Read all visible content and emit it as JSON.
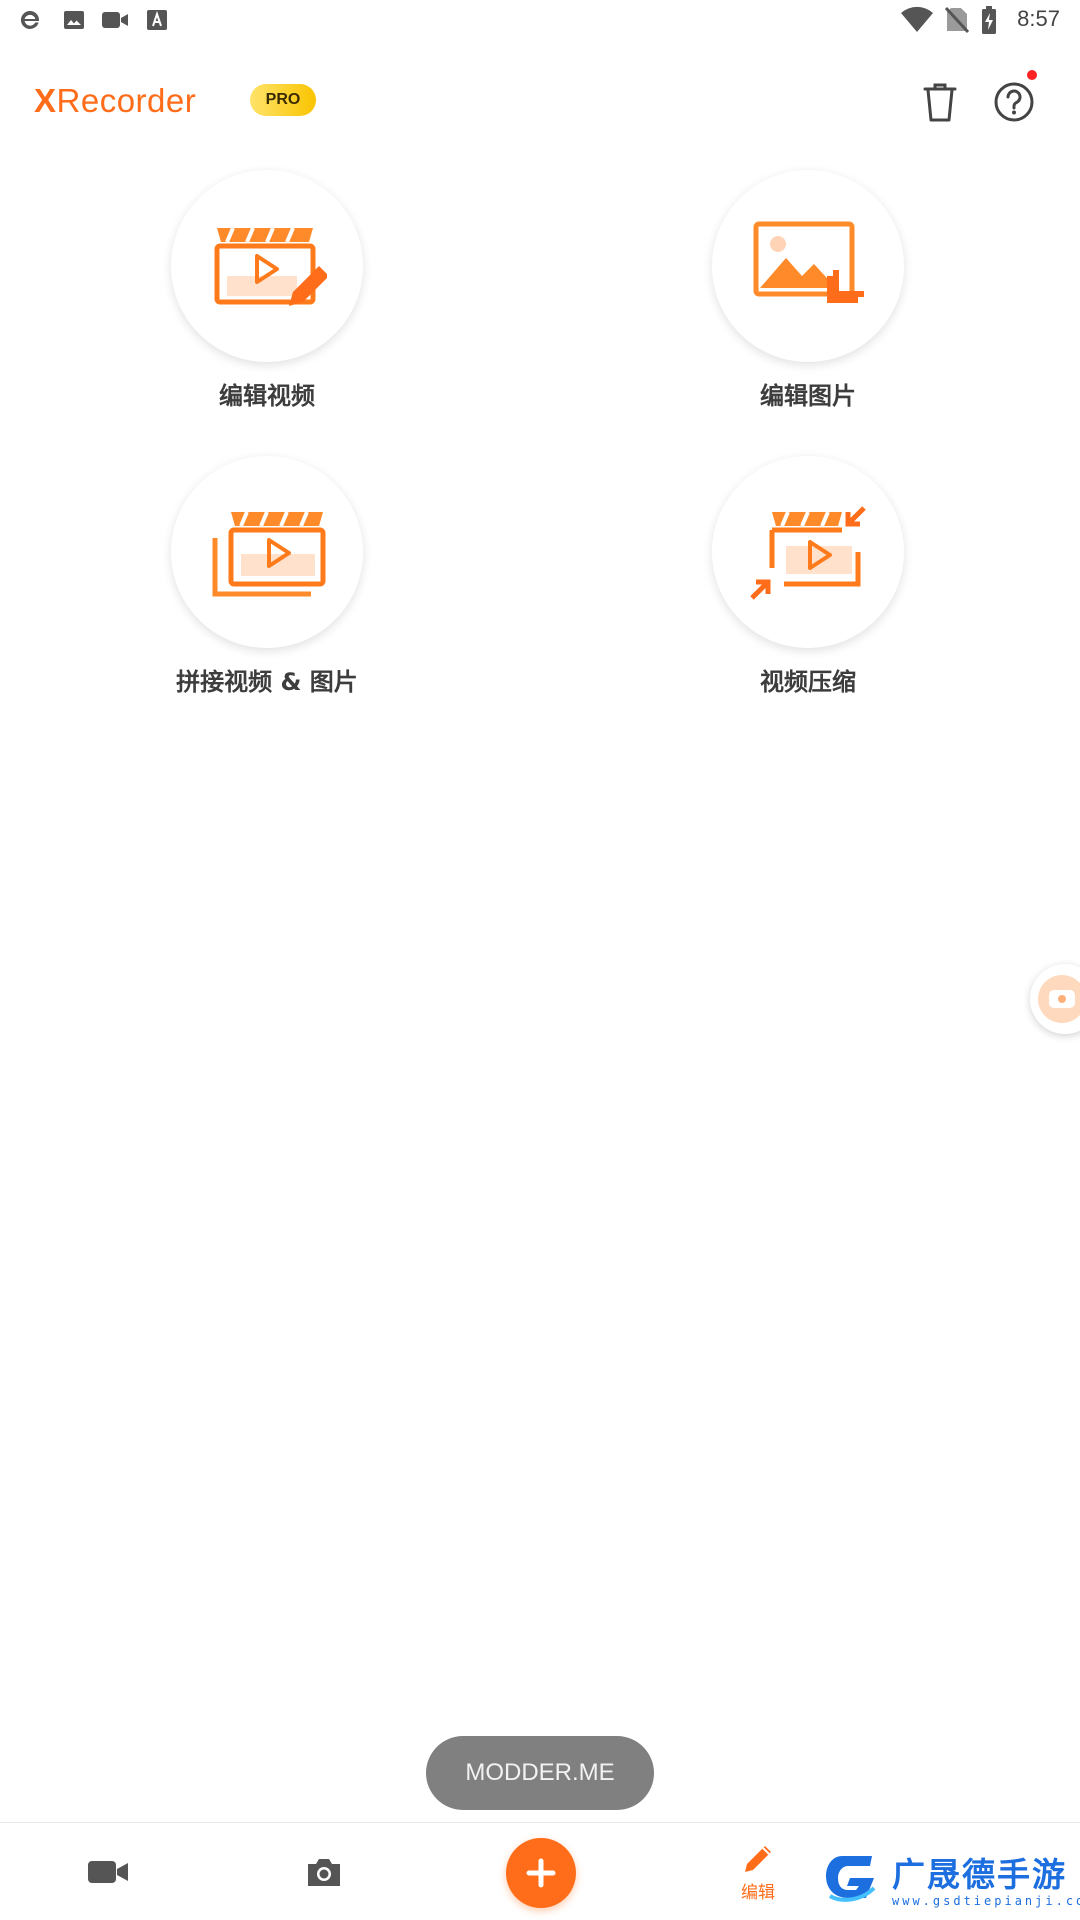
{
  "status_bar": {
    "time": "8:57",
    "left_icons": [
      "browser-icon",
      "image-icon",
      "video-camera-icon",
      "text-icon"
    ],
    "right_icons": [
      "wifi-icon",
      "no-sim-icon",
      "battery-charging-icon"
    ]
  },
  "header": {
    "app_name_x": "X",
    "app_name_rest": "Recorder",
    "badge": "PRO",
    "actions": [
      "trash-icon",
      "help-icon"
    ]
  },
  "tools": [
    {
      "label": "编辑视频",
      "icon": "edit-video-icon"
    },
    {
      "label": "编辑图片",
      "icon": "edit-image-icon"
    },
    {
      "label": "拼接视频 & 图片",
      "icon": "merge-video-image-icon"
    },
    {
      "label": "视频压缩",
      "icon": "compress-video-icon"
    }
  ],
  "toast": {
    "text": "MODDER.ME"
  },
  "bottom_nav": {
    "items": [
      "record-icon",
      "camera-icon",
      "add-icon",
      "edit-icon"
    ],
    "active_label": "编辑"
  },
  "watermark": {
    "text": "广晟德手游",
    "url": "www.gsdtiepianji.com"
  },
  "colors": {
    "accent": "#ff6d1a",
    "badge": "#f9c400",
    "toast_bg": "#808080"
  }
}
